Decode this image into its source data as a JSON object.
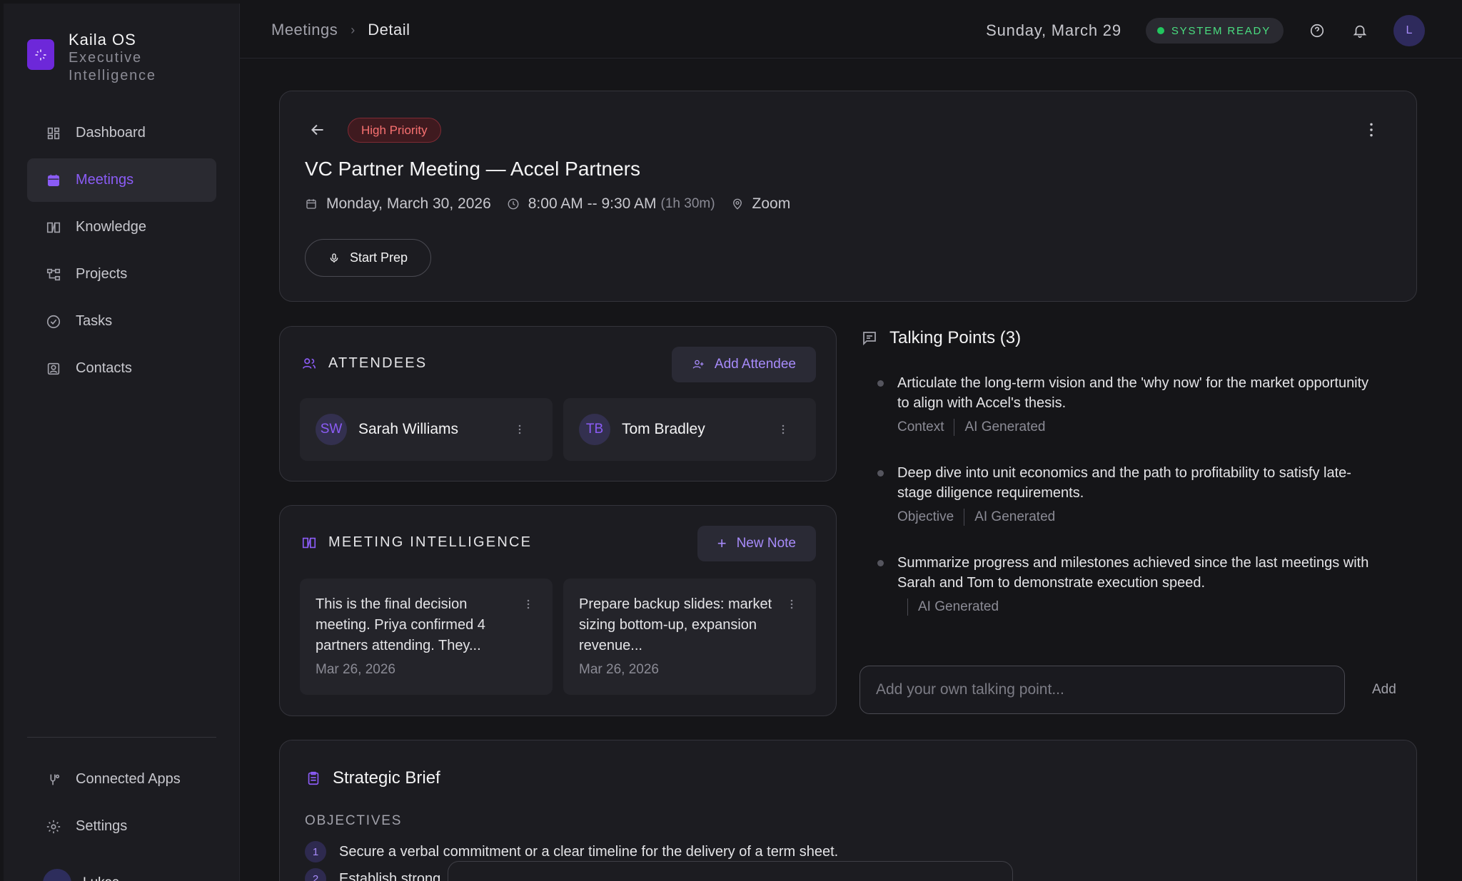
{
  "brand": {
    "name": "Kaila OS",
    "sub_line1": "Executive",
    "sub_line2": "Intelligence"
  },
  "nav": [
    {
      "label": "Dashboard",
      "icon": "dashboard-icon",
      "active": false
    },
    {
      "label": "Meetings",
      "icon": "calendar-icon",
      "active": true
    },
    {
      "label": "Knowledge",
      "icon": "book-icon",
      "active": false
    },
    {
      "label": "Projects",
      "icon": "projects-icon",
      "active": false
    },
    {
      "label": "Tasks",
      "icon": "check-circle-icon",
      "active": false
    },
    {
      "label": "Contacts",
      "icon": "contacts-icon",
      "active": false
    }
  ],
  "nav_bottom": [
    {
      "label": "Connected Apps",
      "icon": "apps-icon"
    },
    {
      "label": "Settings",
      "icon": "gear-icon"
    }
  ],
  "user": {
    "name": "Lukas"
  },
  "breadcrumb": {
    "parent": "Meetings",
    "current": "Detail"
  },
  "header": {
    "date": "Sunday, March 29",
    "status": "SYSTEM READY",
    "avatar_initial": "L"
  },
  "meeting": {
    "priority": "High Priority",
    "title": "VC Partner Meeting — Accel Partners",
    "date": "Monday, March 30, 2026",
    "time": "8:00 AM -- 9:30 AM",
    "duration": "(1h 30m)",
    "location": "Zoom",
    "start_label": "Start Prep"
  },
  "attendees": {
    "title": "ATTENDEES",
    "add_label": "Add Attendee",
    "people": [
      {
        "initials": "SW",
        "name": "Sarah Williams"
      },
      {
        "initials": "TB",
        "name": "Tom Bradley"
      }
    ]
  },
  "intelligence": {
    "title": "MEETING INTELLIGENCE",
    "new_label": "New Note",
    "notes": [
      {
        "text": "This is the final decision meeting. Priya confirmed 4 partners attending. They...",
        "date": "Mar 26, 2026"
      },
      {
        "text": "Prepare backup slides: market sizing bottom-up, expansion revenue...",
        "date": "Mar 26, 2026"
      }
    ]
  },
  "talking_points": {
    "title": "Talking Points (3)",
    "items": [
      {
        "text": "Articulate the long-term vision and the 'why now' for the market opportunity to align with Accel's thesis.",
        "tag": "Context",
        "source": "AI Generated"
      },
      {
        "text": "Deep dive into unit economics and the path to profitability to satisfy late-stage diligence requirements.",
        "tag": "Objective",
        "source": "AI Generated"
      },
      {
        "text": "Summarize progress and milestones achieved since the last meetings with Sarah and Tom to demonstrate execution speed.",
        "tag": "",
        "source": "AI Generated"
      }
    ],
    "input_placeholder": "Add your own talking point...",
    "add_label": "Add"
  },
  "brief": {
    "title": "Strategic Brief",
    "objectives_label": "OBJECTIVES",
    "objectives": [
      {
        "num": "1",
        "text": "Secure a verbal commitment or a clear timeline for the delivery of a term sheet."
      },
      {
        "num": "2",
        "text": "Establish strong"
      }
    ]
  },
  "colors": {
    "accent": "#8b5cf6",
    "status_green": "#22c55e",
    "priority_red": "#f87171"
  }
}
